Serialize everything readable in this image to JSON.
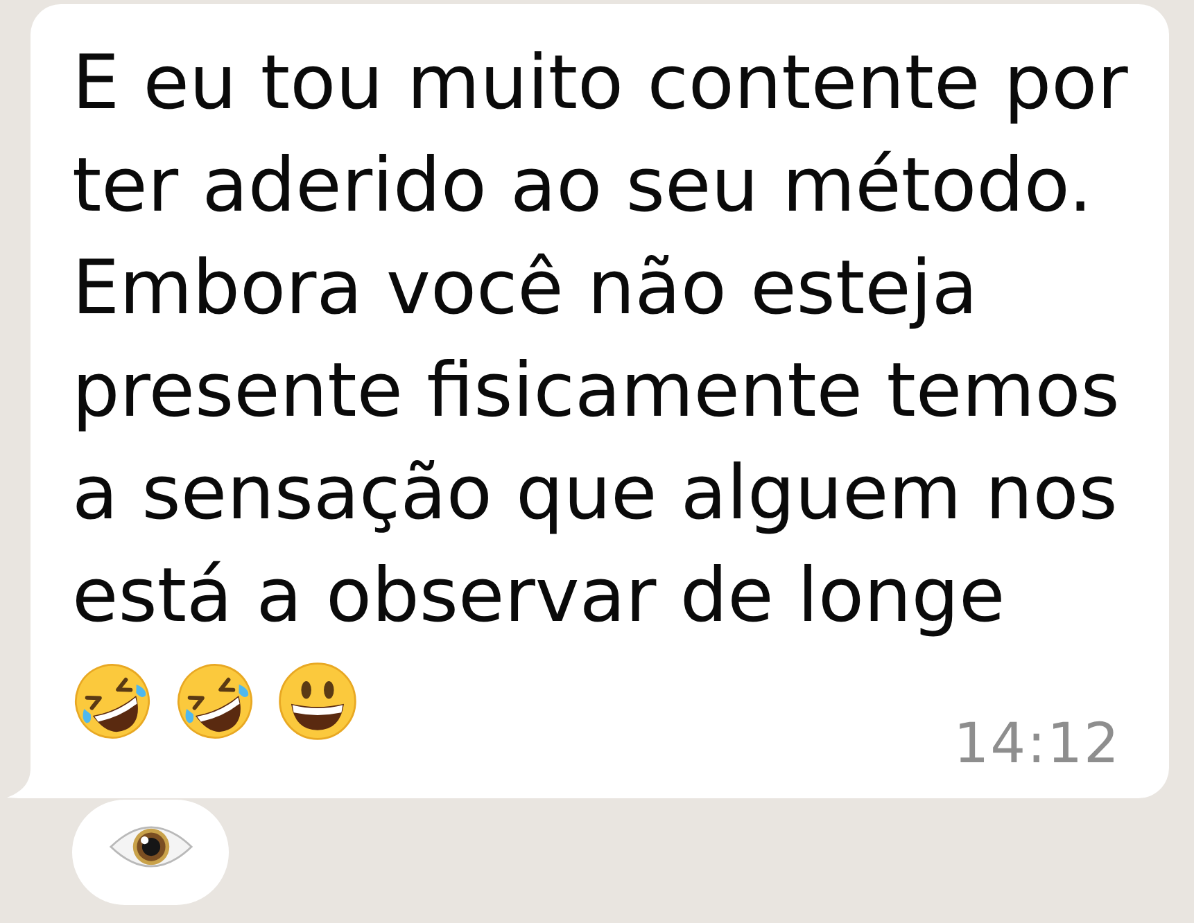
{
  "message": {
    "text": "E eu tou muito contente por ter aderido ao seu método. Embora você não esteja presente fisicamente temos a sensação que alguem nos está a observar de longe",
    "emojis": [
      {
        "kind": "rofl"
      },
      {
        "kind": "rofl"
      },
      {
        "kind": "grinning"
      }
    ],
    "time": "14:12"
  },
  "reactions": [
    {
      "kind": "eye"
    }
  ]
}
